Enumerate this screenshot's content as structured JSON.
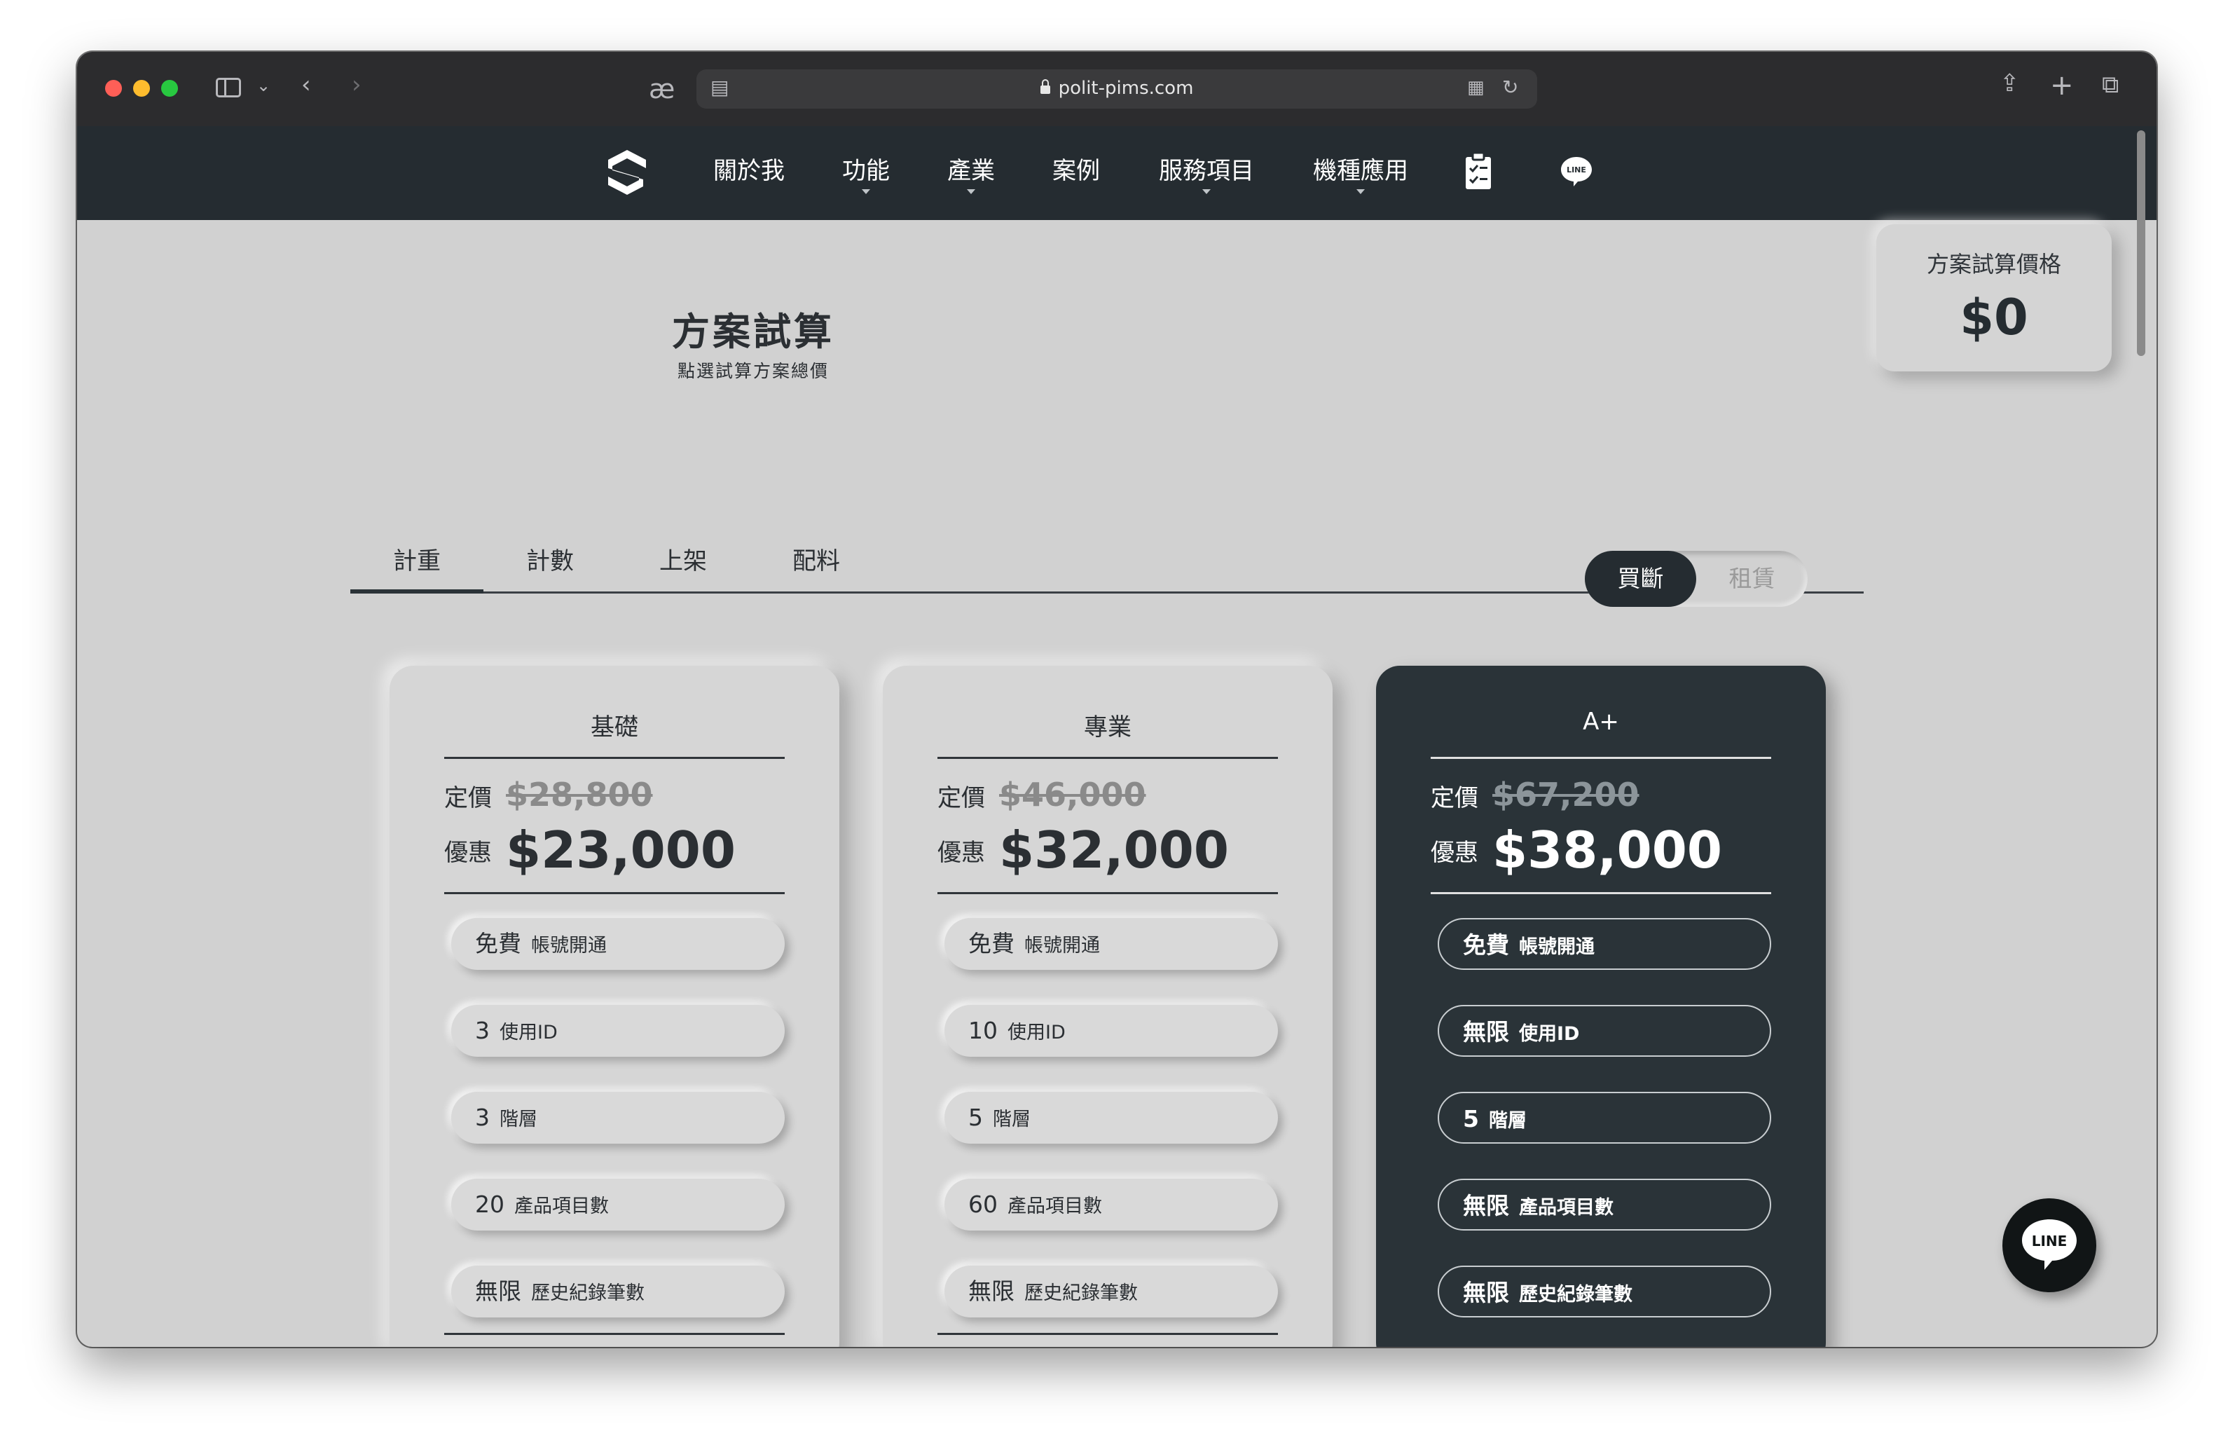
{
  "browser": {
    "url": "polit-pims.com"
  },
  "nav": {
    "items": [
      {
        "label": "關於我",
        "dropdown": false
      },
      {
        "label": "功能",
        "dropdown": true
      },
      {
        "label": "產業",
        "dropdown": true
      },
      {
        "label": "案例",
        "dropdown": false
      },
      {
        "label": "服務項目",
        "dropdown": true
      },
      {
        "label": "機種應用",
        "dropdown": true
      }
    ],
    "line_label": "LINE"
  },
  "page": {
    "title": "方案試算",
    "subtitle": "點選試算方案總價"
  },
  "total": {
    "label": "方案試算價格",
    "value": "$0"
  },
  "tabs": [
    "計重",
    "計數",
    "上架",
    "配料"
  ],
  "active_tab": "計重",
  "purchase_toggle": {
    "options": [
      "買斷",
      "租賃"
    ],
    "selected": "買斷"
  },
  "plans": [
    {
      "name": "基礎",
      "list_label": "定價",
      "list_price": "$28,800",
      "deal_label": "優惠",
      "deal_price": "$23,000",
      "features": [
        {
          "value": "免費",
          "label": "帳號開通"
        },
        {
          "value": "3",
          "label": "使用ID"
        },
        {
          "value": "3",
          "label": "階層"
        },
        {
          "value": "20",
          "label": "產品項目數"
        },
        {
          "value": "無限",
          "label": "歷史紀錄筆數"
        }
      ]
    },
    {
      "name": "專業",
      "list_label": "定價",
      "list_price": "$46,000",
      "deal_label": "優惠",
      "deal_price": "$32,000",
      "features": [
        {
          "value": "免費",
          "label": "帳號開通"
        },
        {
          "value": "10",
          "label": "使用ID"
        },
        {
          "value": "5",
          "label": "階層"
        },
        {
          "value": "60",
          "label": "產品項目數"
        },
        {
          "value": "無限",
          "label": "歷史紀錄筆數"
        }
      ]
    },
    {
      "name": "A+",
      "list_label": "定價",
      "list_price": "$67,200",
      "deal_label": "優惠",
      "deal_price": "$38,000",
      "features": [
        {
          "value": "免費",
          "label": "帳號開通"
        },
        {
          "value": "無限",
          "label": "使用ID"
        },
        {
          "value": "5",
          "label": "階層"
        },
        {
          "value": "無限",
          "label": "產品項目數"
        },
        {
          "value": "無限",
          "label": "歷史紀錄筆數"
        }
      ]
    }
  ],
  "line_fab_label": "LINE",
  "colors": {
    "nav_bg": "#252c31",
    "page_bg": "#d1d1d1",
    "dark_card": "#2a3338"
  }
}
